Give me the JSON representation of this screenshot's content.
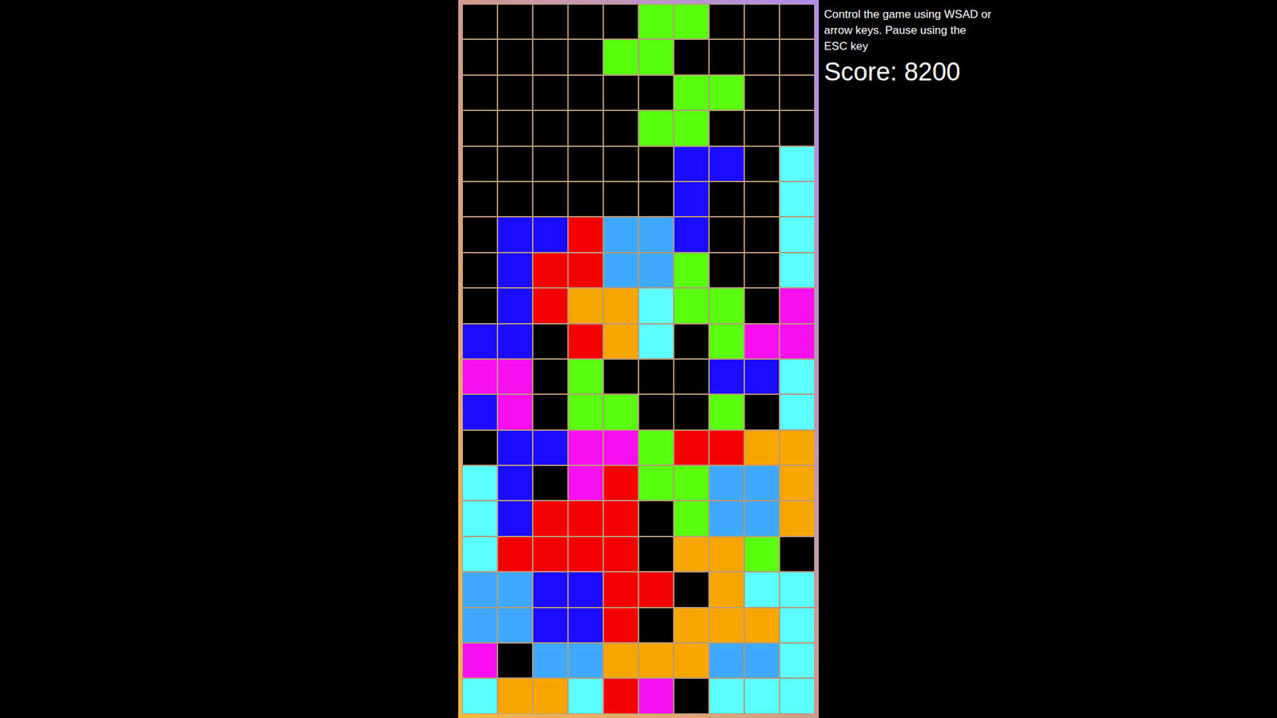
{
  "instructions": "Control the game using WSAD or arrow keys. Pause using the ESC key",
  "score": "Score: 8200",
  "board": {
    "rows": [
      [
        "#000000",
        "#000000",
        "#000000",
        "#000000",
        "#000000",
        "#59ff0f",
        "#59ff0f",
        "#000000",
        "#000000",
        "#000000"
      ],
      [
        "#000000",
        "#000000",
        "#000000",
        "#000000",
        "#59ff0f",
        "#59ff0f",
        "#000000",
        "#000000",
        "#000000",
        "#000000"
      ],
      [
        "#000000",
        "#000000",
        "#000000",
        "#000000",
        "#000000",
        "#000000",
        "#59ff0f",
        "#59ff0f",
        "#000000",
        "#000000"
      ],
      [
        "#000000",
        "#000000",
        "#000000",
        "#000000",
        "#000000",
        "#59ff0f",
        "#59ff0f",
        "#000000",
        "#000000",
        "#000000"
      ],
      [
        "#000000",
        "#000000",
        "#000000",
        "#000000",
        "#000000",
        "#000000",
        "#1c0cff",
        "#1c0cff",
        "#000000",
        "#5cffff"
      ],
      [
        "#000000",
        "#000000",
        "#000000",
        "#000000",
        "#000000",
        "#000000",
        "#1c0cff",
        "#000000",
        "#000000",
        "#5cffff"
      ],
      [
        "#000000",
        "#1c0cff",
        "#1c0cff",
        "#f50000",
        "#3fa9ff",
        "#3fa9ff",
        "#1c0cff",
        "#000000",
        "#000000",
        "#5cffff"
      ],
      [
        "#000000",
        "#1c0cff",
        "#f50000",
        "#f50000",
        "#3fa9ff",
        "#3fa9ff",
        "#59ff0f",
        "#000000",
        "#000000",
        "#5cffff"
      ],
      [
        "#000000",
        "#1c0cff",
        "#f50000",
        "#f7a600",
        "#f7a600",
        "#5cffff",
        "#59ff0f",
        "#59ff0f",
        "#000000",
        "#f70ff0"
      ],
      [
        "#1c0cff",
        "#1c0cff",
        "#000000",
        "#f50000",
        "#f7a600",
        "#5cffff",
        "#000000",
        "#59ff0f",
        "#f70ff0",
        "#f70ff0"
      ],
      [
        "#f70ff0",
        "#f70ff0",
        "#000000",
        "#59ff0f",
        "#000000",
        "#000000",
        "#000000",
        "#1c0cff",
        "#1c0cff",
        "#5cffff"
      ],
      [
        "#1c0cff",
        "#f70ff0",
        "#000000",
        "#59ff0f",
        "#59ff0f",
        "#000000",
        "#000000",
        "#59ff0f",
        "#000000",
        "#5cffff"
      ],
      [
        "#000000",
        "#1c0cff",
        "#1c0cff",
        "#f70ff0",
        "#f70ff0",
        "#59ff0f",
        "#f50000",
        "#f50000",
        "#f7a600",
        "#f7a600"
      ],
      [
        "#5cffff",
        "#1c0cff",
        "#000000",
        "#f70ff0",
        "#f50000",
        "#59ff0f",
        "#59ff0f",
        "#3fa9ff",
        "#3fa9ff",
        "#f7a600"
      ],
      [
        "#5cffff",
        "#1c0cff",
        "#f50000",
        "#f50000",
        "#f50000",
        "#000000",
        "#59ff0f",
        "#3fa9ff",
        "#3fa9ff",
        "#f7a600"
      ],
      [
        "#5cffff",
        "#f50000",
        "#f50000",
        "#f50000",
        "#f50000",
        "#000000",
        "#f7a600",
        "#f7a600",
        "#59ff0f",
        "#000000"
      ],
      [
        "#3fa9ff",
        "#3fa9ff",
        "#1c0cff",
        "#1c0cff",
        "#f50000",
        "#f50000",
        "#000000",
        "#f7a600",
        "#5cffff",
        "#5cffff"
      ],
      [
        "#3fa9ff",
        "#3fa9ff",
        "#1c0cff",
        "#1c0cff",
        "#f50000",
        "#000000",
        "#f7a600",
        "#f7a600",
        "#f7a600",
        "#5cffff"
      ],
      [
        "#f70ff0",
        "#000000",
        "#3fa9ff",
        "#3fa9ff",
        "#f7a600",
        "#f7a600",
        "#f7a600",
        "#3fa9ff",
        "#3fa9ff",
        "#5cffff"
      ],
      [
        "#5cffff",
        "#f7a600",
        "#f7a600",
        "#5cffff",
        "#f50000",
        "#f70ff0",
        "#000000",
        "#5cffff",
        "#5cffff",
        "#5cffff"
      ]
    ]
  }
}
